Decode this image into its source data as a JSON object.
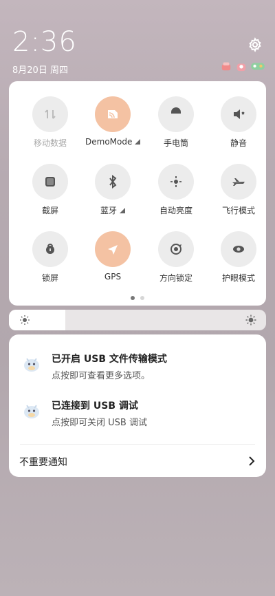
{
  "status": {
    "time": "2:36",
    "date": "8月20日 周四"
  },
  "colors": {
    "active_tile": "#f4c2a3",
    "inactive_tile": "#ececec",
    "active_dot": "#777777",
    "background": "#b6aab1"
  },
  "quick_settings": {
    "tiles": [
      {
        "label": "移动数据",
        "icon": "mobile-data-icon",
        "active": false,
        "dim": true
      },
      {
        "label": "DemoMode",
        "icon": "demo-mode-icon",
        "active": true,
        "dim": false,
        "expandable": true
      },
      {
        "label": "手电筒",
        "icon": "flashlight-icon",
        "active": false,
        "dim": false
      },
      {
        "label": "静音",
        "icon": "mute-icon",
        "active": false,
        "dim": false
      },
      {
        "label": "截屏",
        "icon": "screenshot-icon",
        "active": false,
        "dim": false
      },
      {
        "label": "蓝牙",
        "icon": "bluetooth-icon",
        "active": false,
        "dim": false,
        "expandable": true
      },
      {
        "label": "自动亮度",
        "icon": "auto-brightness-icon",
        "active": false,
        "dim": false
      },
      {
        "label": "飞行模式",
        "icon": "airplane-icon",
        "active": false,
        "dim": false
      },
      {
        "label": "锁屏",
        "icon": "lock-icon",
        "active": false,
        "dim": false
      },
      {
        "label": "GPS",
        "icon": "gps-icon",
        "active": true,
        "dim": false
      },
      {
        "label": "方向锁定",
        "icon": "rotation-lock-icon",
        "active": false,
        "dim": false
      },
      {
        "label": "护眼模式",
        "icon": "eye-care-icon",
        "active": false,
        "dim": false
      }
    ],
    "page_indicator": {
      "current": 1,
      "total": 2
    }
  },
  "brightness": {
    "level": 0.22
  },
  "notifications": {
    "items": [
      {
        "title": "已开启 USB 文件传输模式",
        "subtitle": "点按即可查看更多选项。",
        "icon": "android-app-icon"
      },
      {
        "title": "已连接到 USB 调试",
        "subtitle": "点按即可关闭 USB 调试",
        "icon": "android-app-icon"
      }
    ],
    "footer_label": "不重要通知"
  }
}
